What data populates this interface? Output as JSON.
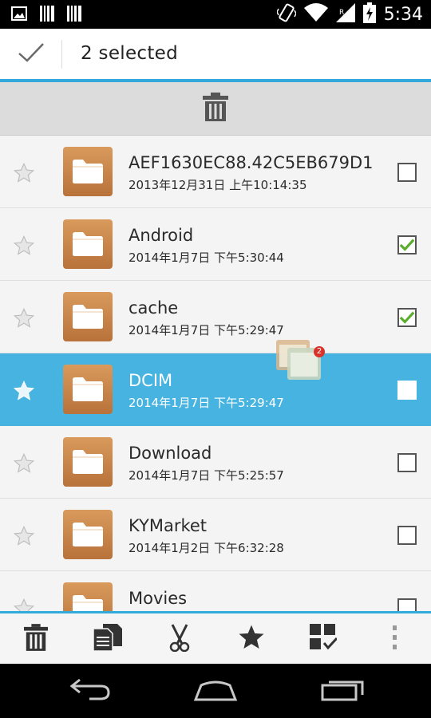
{
  "status_bar": {
    "time": "5:34",
    "left_icons": [
      "image-icon",
      "barcode-icon",
      "barcode-icon"
    ],
    "right_icons": [
      "vibrate-icon",
      "wifi-icon",
      "signal-icon",
      "battery-icon"
    ]
  },
  "action_bar": {
    "done_icon": "check-icon",
    "title": "2  selected"
  },
  "drop_zone": {
    "icon": "trash-icon"
  },
  "files": [
    {
      "name": "AEF1630EC88.42C5EB679D1",
      "date": "2013年12月31日 上午10:14:35",
      "checked": false,
      "highlighted": false
    },
    {
      "name": "Android",
      "date": "2014年1月7日 下午5:30:44",
      "checked": true,
      "highlighted": false
    },
    {
      "name": "cache",
      "date": "2014年1月7日 下午5:29:47",
      "checked": true,
      "highlighted": false
    },
    {
      "name": "DCIM",
      "date": "2014年1月7日 下午5:29:47",
      "checked": false,
      "highlighted": true
    },
    {
      "name": "Download",
      "date": "2014年1月7日 下午5:25:57",
      "checked": false,
      "highlighted": false
    },
    {
      "name": "KYMarket",
      "date": "2014年1月2日 下午6:32:28",
      "checked": false,
      "highlighted": false
    },
    {
      "name": "Movies",
      "date": "",
      "checked": false,
      "highlighted": false
    }
  ],
  "drag_badge": "2",
  "bottom_actions": [
    "trash-icon",
    "copy-icon",
    "scissors-icon",
    "star-icon",
    "select-grid-icon",
    "overflow-menu-icon"
  ],
  "nav_buttons": [
    "back-icon",
    "home-icon",
    "recents-icon"
  ],
  "colors": {
    "accent": "#33a9dc",
    "highlight": "#46b3e1",
    "folder": "#c9834a",
    "check": "#5aae2c"
  }
}
